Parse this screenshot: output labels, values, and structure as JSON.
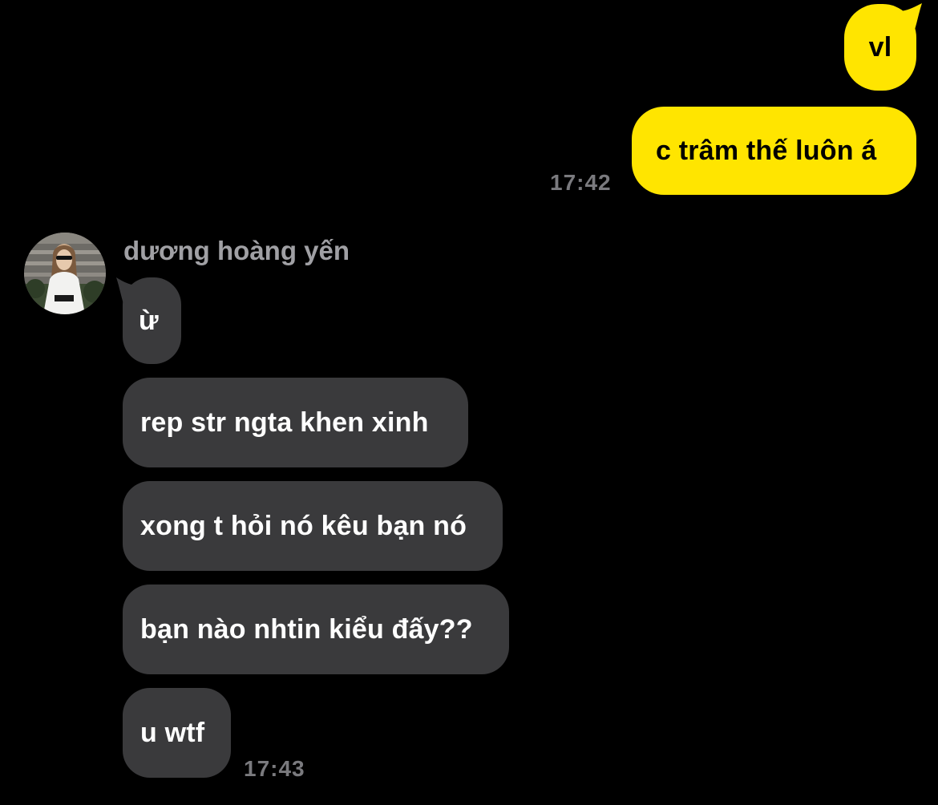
{
  "colors": {
    "background": "#000000",
    "outgoing_bubble": "#ffe500",
    "incoming_bubble": "#3a3a3c",
    "timestamp": "#7a7a7e",
    "sender_name": "#a0a0a4"
  },
  "outgoing": {
    "messages": [
      {
        "text": "vl"
      },
      {
        "text": "c trâm thế luôn á"
      }
    ],
    "timestamp": "17:42"
  },
  "incoming": {
    "sender_name": "dương hoàng yến",
    "avatar_icon": "avatar-photo",
    "messages": [
      {
        "text": "ừ"
      },
      {
        "text": "rep str ngta khen xinh"
      },
      {
        "text": "xong t hỏi nó kêu bạn nó"
      },
      {
        "text": "bạn nào nhtin kiểu đấy??"
      },
      {
        "text": "u wtf"
      }
    ],
    "timestamp": "17:43"
  }
}
